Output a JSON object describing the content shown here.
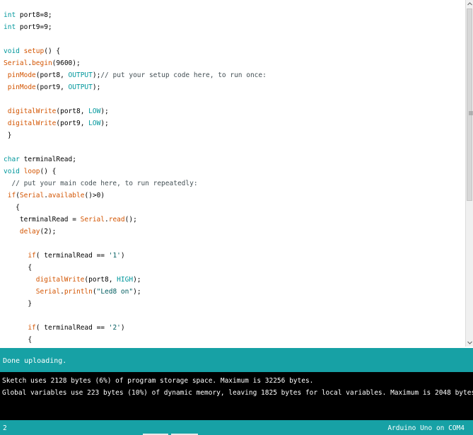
{
  "editor": {
    "lines": [
      [
        {
          "t": "int",
          "c": "kw"
        },
        {
          "t": " port8=8;",
          "c": "plain"
        }
      ],
      [
        {
          "t": "int",
          "c": "kw"
        },
        {
          "t": " port9=9;",
          "c": "plain"
        }
      ],
      [],
      [
        {
          "t": "void",
          "c": "kw"
        },
        {
          "t": " ",
          "c": "plain"
        },
        {
          "t": "setup",
          "c": "fn"
        },
        {
          "t": "() {",
          "c": "plain"
        }
      ],
      [
        {
          "t": "Serial",
          "c": "fn"
        },
        {
          "t": ".",
          "c": "plain"
        },
        {
          "t": "begin",
          "c": "fn"
        },
        {
          "t": "(9600);",
          "c": "plain"
        }
      ],
      [
        {
          "t": " ",
          "c": "plain"
        },
        {
          "t": "pinMode",
          "c": "fn"
        },
        {
          "t": "(port8, ",
          "c": "plain"
        },
        {
          "t": "OUTPUT",
          "c": "const"
        },
        {
          "t": ");",
          "c": "plain"
        },
        {
          "t": "// put your setup code here, to run once:",
          "c": "com"
        }
      ],
      [
        {
          "t": " ",
          "c": "plain"
        },
        {
          "t": "pinMode",
          "c": "fn"
        },
        {
          "t": "(port9, ",
          "c": "plain"
        },
        {
          "t": "OUTPUT",
          "c": "const"
        },
        {
          "t": ");",
          "c": "plain"
        }
      ],
      [],
      [
        {
          "t": " ",
          "c": "plain"
        },
        {
          "t": "digitalWrite",
          "c": "fn"
        },
        {
          "t": "(port8, ",
          "c": "plain"
        },
        {
          "t": "LOW",
          "c": "const"
        },
        {
          "t": ");",
          "c": "plain"
        }
      ],
      [
        {
          "t": " ",
          "c": "plain"
        },
        {
          "t": "digitalWrite",
          "c": "fn"
        },
        {
          "t": "(port9, ",
          "c": "plain"
        },
        {
          "t": "LOW",
          "c": "const"
        },
        {
          "t": ");",
          "c": "plain"
        }
      ],
      [
        {
          "t": " }",
          "c": "plain"
        }
      ],
      [],
      [
        {
          "t": "char",
          "c": "kw"
        },
        {
          "t": " terminalRead;",
          "c": "plain"
        }
      ],
      [
        {
          "t": "void",
          "c": "kw"
        },
        {
          "t": " ",
          "c": "plain"
        },
        {
          "t": "loop",
          "c": "fn"
        },
        {
          "t": "() {",
          "c": "plain"
        }
      ],
      [
        {
          "t": "  // put your main code here, to run repeatedly:",
          "c": "com"
        }
      ],
      [
        {
          "t": " ",
          "c": "plain"
        },
        {
          "t": "if",
          "c": "fn"
        },
        {
          "t": "(",
          "c": "plain"
        },
        {
          "t": "Serial",
          "c": "fn"
        },
        {
          "t": ".",
          "c": "plain"
        },
        {
          "t": "available",
          "c": "fn"
        },
        {
          "t": "()>0)",
          "c": "plain"
        }
      ],
      [
        {
          "t": "   {",
          "c": "plain"
        }
      ],
      [
        {
          "t": "    terminalRead = ",
          "c": "plain"
        },
        {
          "t": "Serial",
          "c": "fn"
        },
        {
          "t": ".",
          "c": "plain"
        },
        {
          "t": "read",
          "c": "fn"
        },
        {
          "t": "();",
          "c": "plain"
        }
      ],
      [
        {
          "t": "    ",
          "c": "plain"
        },
        {
          "t": "delay",
          "c": "fn"
        },
        {
          "t": "(2);",
          "c": "plain"
        }
      ],
      [],
      [
        {
          "t": "      ",
          "c": "plain"
        },
        {
          "t": "if",
          "c": "fn"
        },
        {
          "t": "( terminalRead == ",
          "c": "plain"
        },
        {
          "t": "'1'",
          "c": "str"
        },
        {
          "t": ")",
          "c": "plain"
        }
      ],
      [
        {
          "t": "      {",
          "c": "plain"
        }
      ],
      [
        {
          "t": "        ",
          "c": "plain"
        },
        {
          "t": "digitalWrite",
          "c": "fn"
        },
        {
          "t": "(port8, ",
          "c": "plain"
        },
        {
          "t": "HIGH",
          "c": "const"
        },
        {
          "t": ");",
          "c": "plain"
        }
      ],
      [
        {
          "t": "        ",
          "c": "plain"
        },
        {
          "t": "Serial",
          "c": "fn"
        },
        {
          "t": ".",
          "c": "plain"
        },
        {
          "t": "println",
          "c": "fn"
        },
        {
          "t": "(",
          "c": "plain"
        },
        {
          "t": "\"Led8 on\"",
          "c": "str"
        },
        {
          "t": ");",
          "c": "plain"
        }
      ],
      [
        {
          "t": "      }",
          "c": "plain"
        }
      ],
      [],
      [
        {
          "t": "      ",
          "c": "plain"
        },
        {
          "t": "if",
          "c": "fn"
        },
        {
          "t": "( terminalRead == ",
          "c": "plain"
        },
        {
          "t": "'2'",
          "c": "str"
        },
        {
          "t": ")",
          "c": "plain"
        }
      ],
      [
        {
          "t": "      {",
          "c": "plain"
        }
      ]
    ]
  },
  "status": {
    "message": "Done uploading."
  },
  "console": {
    "lines": [
      "Sketch uses 2128 bytes (6%) of program storage space. Maximum is 32256 bytes.",
      "Global variables use 223 bytes (10%) of dynamic memory, leaving 1825 bytes for local variables. Maximum is 2048 bytes."
    ]
  },
  "footer": {
    "line_number": "2",
    "board": "Arduino Uno on COM4"
  },
  "colors": {
    "status_bar": "#17a1a5",
    "console_bg": "#000000",
    "keyword": "#00979c",
    "function": "#d35400",
    "comment": "#434f54"
  },
  "icons": {
    "scroll_up": "arrow-up-icon",
    "scroll_down": "arrow-down-icon",
    "scroll_grip": "grip-icon"
  }
}
